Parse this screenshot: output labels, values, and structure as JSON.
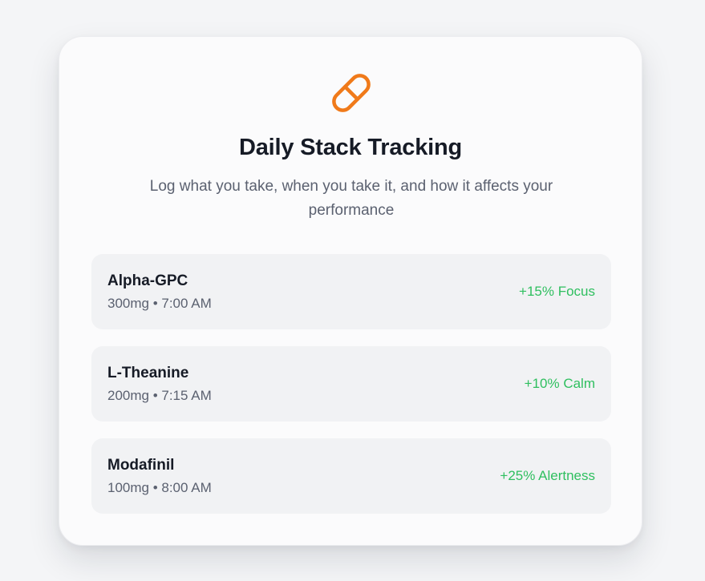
{
  "colors": {
    "accent": "#f07a1a",
    "effect_positive": "#2fbf5f",
    "title": "#161b26",
    "muted": "#5b6170"
  },
  "header": {
    "icon": "pill-icon",
    "title": "Daily Stack Tracking",
    "subtitle": "Log what you take, when you take it, and how it affects your performance"
  },
  "entries": [
    {
      "name": "Alpha-GPC",
      "detail": "300mg • 7:00 AM",
      "effect": "+15% Focus"
    },
    {
      "name": "L-Theanine",
      "detail": "200mg • 7:15 AM",
      "effect": "+10% Calm"
    },
    {
      "name": "Modafinil",
      "detail": "100mg • 8:00 AM",
      "effect": "+25% Alertness"
    }
  ]
}
